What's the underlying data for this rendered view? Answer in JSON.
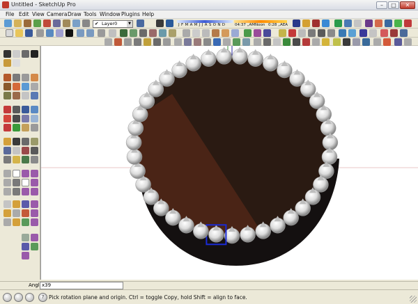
{
  "window": {
    "title": "Untitled - SketchUp Pro",
    "min_label": "–",
    "max_label": "□",
    "close_label": "✕"
  },
  "menu": {
    "items": [
      "File",
      "Edit",
      "View",
      "Camera",
      "Draw",
      "Tools",
      "Window",
      "Plugins",
      "Help"
    ]
  },
  "toolbar": {
    "layer_check": "✔",
    "layer_name": "Layer0",
    "shadow_months": "J F M A M J J A S O N D",
    "shadow_time_1": "04:37 „AM",
    "shadow_time_2": "Noon",
    "shadow_time_3": "0:28 „AEA"
  },
  "vcb": {
    "label": "Angle",
    "value": "x39"
  },
  "status": {
    "message": "Pick rotation plane and origin.  Ctrl = toggle Copy, hold Shift = align to face.",
    "help_icon": "?"
  },
  "colors": {
    "face_dark": "#2a1a12",
    "face_light": "#4a2416",
    "side": "#141010",
    "pearl": "#f2f2f2",
    "selection": "#1a2bd6",
    "axis_blue": "#2a2aa0",
    "axis_red": "#b84a4a",
    "axis_green": "#3a9a3a"
  },
  "scene": {
    "pearl_count": 39,
    "selected_index": 1
  }
}
